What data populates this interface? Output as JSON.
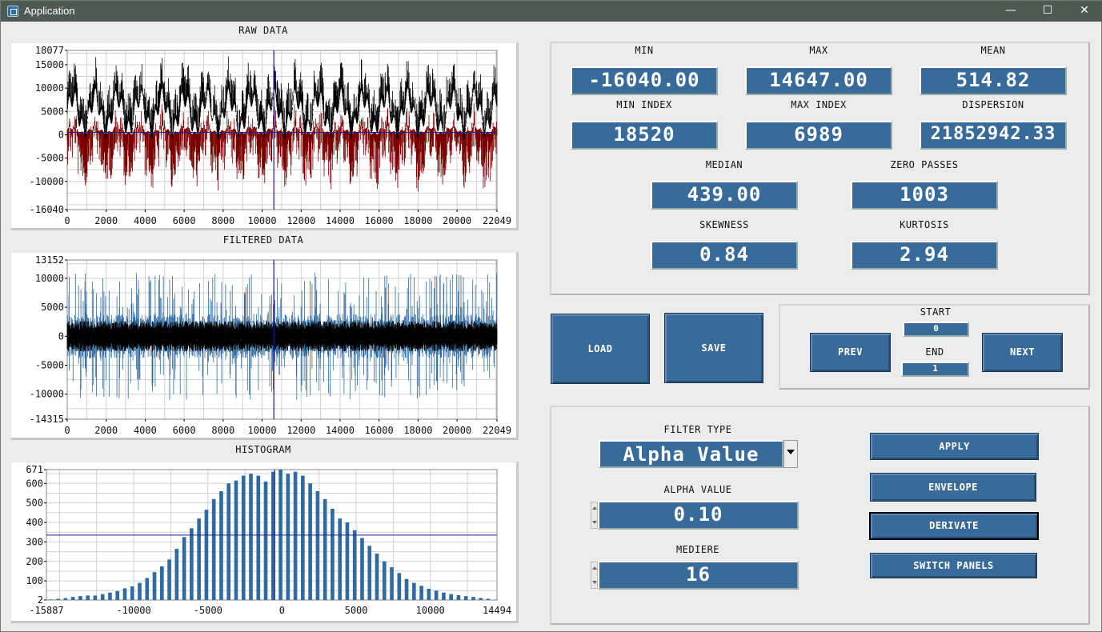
{
  "window": {
    "title": "Application",
    "minimize": "—",
    "maximize": "☐",
    "close": "✕"
  },
  "graphs": {
    "raw": {
      "title": "RAW DATA",
      "yticks": [
        "18077",
        "15000",
        "10000",
        "5000",
        "0",
        "-5000",
        "-10000",
        "-16040"
      ],
      "xticks": [
        "0",
        "2000",
        "4000",
        "6000",
        "8000",
        "10000",
        "12000",
        "14000",
        "16000",
        "18000",
        "20000",
        "22049"
      ]
    },
    "filtered": {
      "title": "FILTERED DATA",
      "yticks": [
        "13152",
        "10000",
        "5000",
        "0",
        "-5000",
        "-10000",
        "-14315"
      ],
      "xticks": [
        "0",
        "2000",
        "4000",
        "6000",
        "8000",
        "10000",
        "12000",
        "14000",
        "16000",
        "18000",
        "20000",
        "22049"
      ]
    },
    "histogram": {
      "title": "HISTOGRAM",
      "yticks": [
        "671",
        "600",
        "500",
        "400",
        "300",
        "200",
        "100",
        "2"
      ],
      "xticks": [
        "-15887",
        "-10000",
        "-5000",
        "0",
        "5000",
        "10000",
        "14494"
      ]
    }
  },
  "chart_data": [
    {
      "type": "line",
      "title": "RAW DATA",
      "x_range": [
        0,
        22049
      ],
      "ylim": [
        -16040,
        18077
      ],
      "series": [
        {
          "name": "",
          "color": "#000000"
        },
        {
          "name": "",
          "color": "#7a0000"
        }
      ],
      "cursor_x": 10600,
      "cursor_y": 514.82
    },
    {
      "type": "line",
      "title": "FILTERED DATA",
      "x_range": [
        0,
        22049
      ],
      "ylim": [
        -14315,
        13152
      ],
      "series": [
        {
          "name": "",
          "color": "#2f6aa0"
        },
        {
          "name": "",
          "color": "#000000"
        }
      ],
      "cursor_x": 10600
    },
    {
      "type": "bar",
      "title": "HISTOGRAM",
      "x_range": [
        -15887,
        14494
      ],
      "ylim": [
        2,
        671
      ],
      "x": [
        -15600,
        -15100,
        -14600,
        -14100,
        -13600,
        -13100,
        -12600,
        -12100,
        -11600,
        -11100,
        -10600,
        -10100,
        -9600,
        -9100,
        -8600,
        -8100,
        -7600,
        -7100,
        -6600,
        -6100,
        -5600,
        -5100,
        -4600,
        -4100,
        -3600,
        -3100,
        -2600,
        -2100,
        -1600,
        -1100,
        -600,
        -100,
        400,
        900,
        1400,
        1900,
        2400,
        2900,
        3400,
        3900,
        4400,
        4900,
        5400,
        5900,
        6400,
        6900,
        7400,
        7900,
        8400,
        8900,
        9400,
        9900,
        10400,
        10900,
        11400,
        11900,
        12400,
        12900,
        13400,
        13900,
        14400
      ],
      "values": [
        5,
        8,
        12,
        18,
        22,
        25,
        25,
        32,
        40,
        48,
        62,
        72,
        90,
        115,
        145,
        175,
        210,
        265,
        325,
        370,
        420,
        465,
        520,
        560,
        600,
        615,
        640,
        650,
        640,
        610,
        660,
        671,
        650,
        660,
        640,
        600,
        560,
        520,
        470,
        420,
        400,
        360,
        320,
        280,
        240,
        200,
        170,
        140,
        110,
        90,
        75,
        60,
        50,
        40,
        32,
        27,
        22,
        18,
        12,
        8,
        4
      ],
      "cursor_y": 335
    }
  ],
  "stats": {
    "min": {
      "label": "MIN",
      "value": "-16040.00"
    },
    "max": {
      "label": "MAX",
      "value": "14647.00"
    },
    "mean": {
      "label": "MEAN",
      "value": "514.82"
    },
    "min_index": {
      "label": "MIN INDEX",
      "value": "18520"
    },
    "max_index": {
      "label": "MAX INDEX",
      "value": "6989"
    },
    "dispersion": {
      "label": "DISPERSION",
      "value": "21852942.33"
    },
    "median": {
      "label": "MEDIAN",
      "value": "439.00"
    },
    "zero_passes": {
      "label": "ZERO PASSES",
      "value": "1003"
    },
    "skewness": {
      "label": "SKEWNESS",
      "value": "0.84"
    },
    "kurtosis": {
      "label": "KURTOSIS",
      "value": "2.94"
    }
  },
  "buttons": {
    "load": "LOAD",
    "save": "SAVE",
    "prev": "PREV",
    "next": "NEXT",
    "apply": "APPLY",
    "envelope": "ENVELOPE",
    "derivate": "DERIVATE",
    "switch_panels": "SWITCH PANELS"
  },
  "nav": {
    "start_label": "START",
    "start_value": "0",
    "end_label": "END",
    "end_value": "1"
  },
  "filter": {
    "type_label": "FILTER TYPE",
    "type_value": "Alpha Value",
    "alpha_label": "ALPHA VALUE",
    "alpha_value": "0.10",
    "mediere_label": "MEDIERE",
    "mediere_value": "16"
  }
}
